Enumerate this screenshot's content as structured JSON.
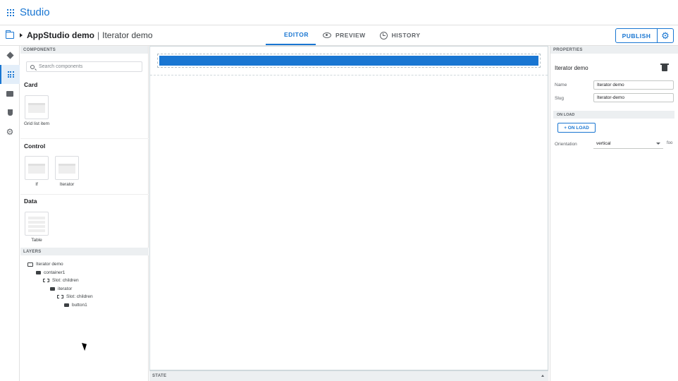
{
  "app": {
    "brand": "Studio"
  },
  "breadcrumb": {
    "app_name": "AppStudio demo",
    "separator": "|",
    "page_name": "Iterator demo"
  },
  "tabs": [
    {
      "label": "EDITOR",
      "icon": "dashboard-icon",
      "active": true
    },
    {
      "label": "PREVIEW",
      "icon": "eye-icon",
      "active": false
    },
    {
      "label": "HISTORY",
      "icon": "history-icon",
      "active": false
    }
  ],
  "toolbar": {
    "publish_label": "PUBLISH",
    "settings_icon": "gear-icon"
  },
  "rail": [
    "layers-icon",
    "grid-icon",
    "image-icon",
    "plug-icon",
    "gear-icon"
  ],
  "components": {
    "header": "COMPONENTS",
    "search_placeholder": "Search components",
    "groups": [
      {
        "title": "Card",
        "items": [
          {
            "label": "Grid list item"
          }
        ]
      },
      {
        "title": "Control",
        "items": [
          {
            "label": "If"
          },
          {
            "label": "Iterator"
          }
        ]
      },
      {
        "title": "Data",
        "items": [
          {
            "label": "Table"
          }
        ]
      }
    ]
  },
  "layers": {
    "header": "LAYERS",
    "tree": [
      {
        "label": "Iterator demo",
        "icon": "page-icon"
      },
      {
        "label": "container1",
        "icon": "component-icon"
      },
      {
        "label": "Slot: children",
        "icon": "slot-icon"
      },
      {
        "label": "iterator",
        "icon": "component-icon"
      },
      {
        "label": "Slot: children",
        "icon": "slot-icon"
      },
      {
        "label": "button1",
        "icon": "component-icon"
      }
    ]
  },
  "state_bar": {
    "label": "STATE"
  },
  "properties": {
    "header": "PROPERTIES",
    "title": "Iterator demo",
    "name_label": "Name",
    "name_value": "Iterator demo",
    "slug_label": "Slug",
    "slug_value": "Iterator-demo",
    "onload_header": "ON LOAD",
    "onload_button": "+ ON LOAD",
    "orientation_label": "Orientation",
    "orientation_value": "vertical",
    "orientation_suffix": "foo"
  },
  "colors": {
    "accent": "#1976d2"
  }
}
